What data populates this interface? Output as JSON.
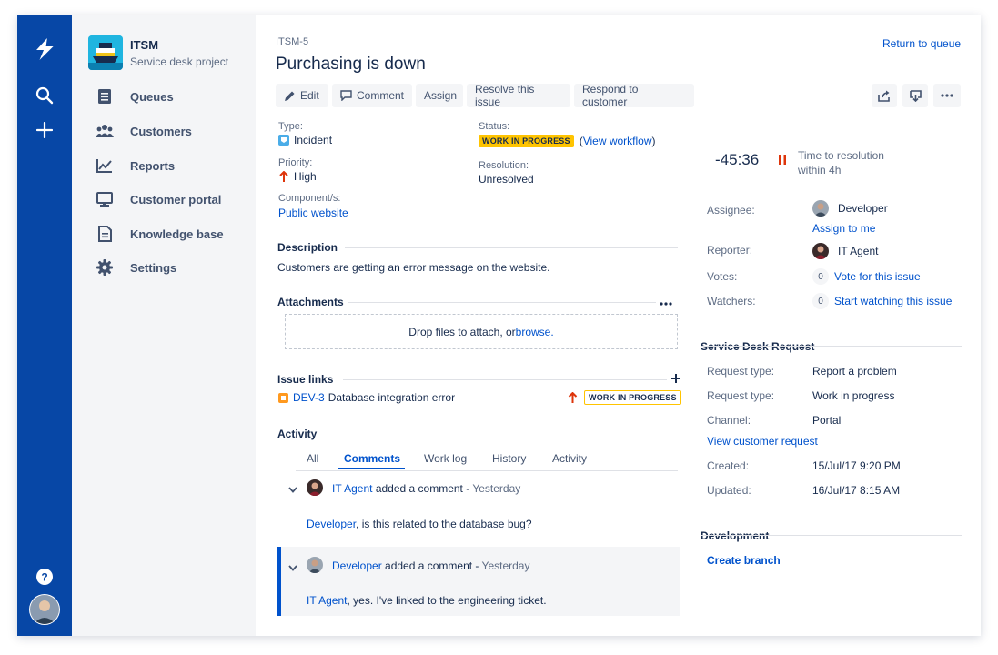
{
  "project": {
    "name": "ITSM",
    "subtitle": "Service desk project"
  },
  "sidebar": {
    "items": [
      {
        "label": "Queues",
        "icon": "queues-icon"
      },
      {
        "label": "Customers",
        "icon": "customers-icon"
      },
      {
        "label": "Reports",
        "icon": "reports-icon"
      },
      {
        "label": "Customer portal",
        "icon": "portal-icon"
      },
      {
        "label": "Knowledge base",
        "icon": "knowledge-icon"
      },
      {
        "label": "Settings",
        "icon": "gear-icon"
      }
    ]
  },
  "issue": {
    "key": "ITSM-5",
    "title": "Purchasing is down",
    "return_link": "Return to queue"
  },
  "toolbar": {
    "edit": "Edit",
    "comment": "Comment",
    "assign": "Assign",
    "resolve": "Resolve this issue",
    "respond": "Respond to customer"
  },
  "details": {
    "type_label": "Type:",
    "type_value": "Incident",
    "priority_label": "Priority:",
    "priority_value": "High",
    "component_label": "Component/s:",
    "component_value": "Public website",
    "status_label": "Status:",
    "status_value": "WORK IN PROGRESS",
    "workflow_open": "(",
    "workflow_link": "View workflow",
    "workflow_close": ")",
    "resolution_label": "Resolution:",
    "resolution_value": "Unresolved"
  },
  "description": {
    "heading": "Description",
    "text": "Customers are getting an error message on the website."
  },
  "attachments": {
    "heading": "Attachments",
    "drop_text": "Drop files to attach, or ",
    "browse": "browse."
  },
  "issue_links": {
    "heading": "Issue links",
    "key": "DEV-3",
    "summary": "Database integration error",
    "status": "WORK IN PROGRESS"
  },
  "activity": {
    "heading": "Activity",
    "tabs": [
      "All",
      "Comments",
      "Work log",
      "History",
      "Activity"
    ],
    "active_tab": "Comments",
    "comments": [
      {
        "author": "IT Agent",
        "action": " added a comment - ",
        "time": "Yesterday",
        "mention": "Developer",
        "body": ", is this related to the database bug?"
      },
      {
        "author": "Developer",
        "action": " added a comment - ",
        "time": "Yesterday",
        "mention": "IT Agent",
        "body": ", yes. I've linked to the engineering ticket."
      }
    ]
  },
  "sla": {
    "time": "-45:36",
    "label": "Time to resolution",
    "target": "within 4h"
  },
  "people": {
    "assignee_label": "Assignee:",
    "assignee": "Developer",
    "assign_to_me": "Assign to me",
    "reporter_label": "Reporter:",
    "reporter": "IT Agent",
    "votes_label": "Votes:",
    "votes_count": "0",
    "vote_link": "Vote for this issue",
    "watchers_label": "Watchers:",
    "watchers_count": "0",
    "watch_link": "Start watching this issue"
  },
  "request": {
    "heading": "Service Desk Request",
    "type_label": "Request type:",
    "type_value": "Report a problem",
    "type2_label": "Request type:",
    "type2_value": "Work in progress",
    "channel_label": "Channel:",
    "channel_value": "Portal",
    "view_link": "View customer request",
    "created_label": "Created:",
    "created_value": "15/Jul/17 9:20 PM",
    "updated_label": "Updated:",
    "updated_value": "16/Jul/17 8:15 AM"
  },
  "development": {
    "heading": "Development",
    "create_branch": "Create branch"
  },
  "colors": {
    "global_nav": "#0747a6",
    "link": "#0052cc",
    "lozenge": "#ffc400",
    "priority_high": "#de350b"
  }
}
